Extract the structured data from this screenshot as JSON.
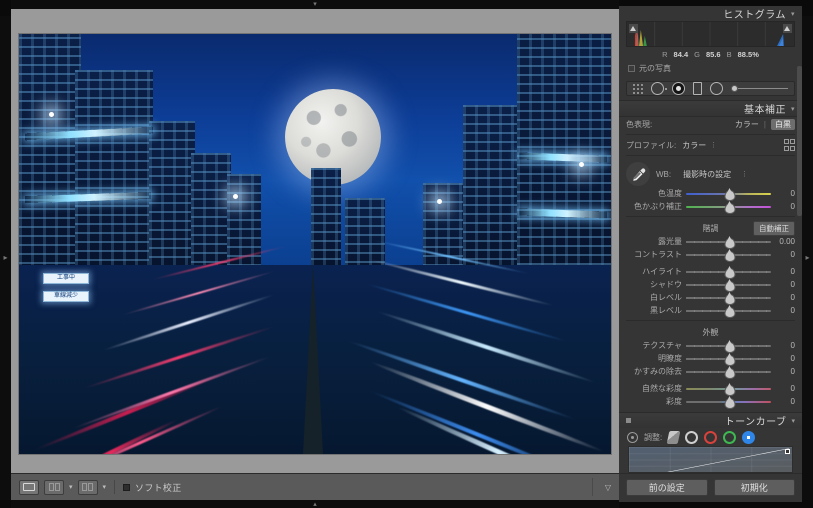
{
  "histogram": {
    "title": "ヒストグラム",
    "collapse_icon": "triangle-down-icon",
    "readout": {
      "r_label": "R",
      "r_value": "84.4",
      "g_label": "G",
      "g_value": "85.6",
      "b_label": "B",
      "b_value": "88.5%"
    },
    "original_photo_label": "元の写真",
    "shadow_clip_icon": "shadow-clipping-icon",
    "highlight_clip_icon": "highlight-clipping-icon"
  },
  "toolstrip": {
    "mask_icon": "mask-grid-icon",
    "spot_icon": "spot-removal-icon",
    "redeye_icon": "red-eye-icon",
    "crop_icon": "crop-overlay-icon",
    "radial_icon": "radial-filter-icon",
    "slider_icon": "amount-slider"
  },
  "basic": {
    "title": "基本補正",
    "treatment_label": "色表現:",
    "treatment_color": "カラー",
    "treatment_bw": "白黒",
    "profile_label": "プロファイル:",
    "profile_value": "カラー",
    "profile_menu_icon": "chevron-icon",
    "profile_browser_icon": "profile-browser-icon",
    "eyedropper_icon": "white-balance-eyedropper-icon",
    "wb_label": "WB:",
    "wb_value": "撮影時の設定",
    "wb_menu_icon": "chevron-icon",
    "wb_sliders": [
      {
        "name": "色温度",
        "value": "0",
        "track": "temp"
      },
      {
        "name": "色かぶり補正",
        "value": "0",
        "track": "tint"
      }
    ],
    "tone_title": "階調",
    "auto_label": "自動補正",
    "tone_sliders": [
      {
        "name": "露光量",
        "value": "0.00",
        "track": "plain"
      },
      {
        "name": "コントラスト",
        "value": "0",
        "track": "plain"
      }
    ],
    "tone_sliders2": [
      {
        "name": "ハイライト",
        "value": "0",
        "track": "plain"
      },
      {
        "name": "シャドウ",
        "value": "0",
        "track": "plain"
      },
      {
        "name": "白レベル",
        "value": "0",
        "track": "plain"
      },
      {
        "name": "黒レベル",
        "value": "0",
        "track": "plain"
      }
    ],
    "presence_title": "外観",
    "presence_sliders": [
      {
        "name": "テクスチャ",
        "value": "0",
        "track": "plain"
      },
      {
        "name": "明瞭度",
        "value": "0",
        "track": "plain"
      },
      {
        "name": "かすみの除去",
        "value": "0",
        "track": "plain"
      }
    ],
    "presence_sliders2": [
      {
        "name": "自然な彩度",
        "value": "0",
        "track": "vib"
      },
      {
        "name": "彩度",
        "value": "0",
        "track": "sat"
      }
    ]
  },
  "tone_curve": {
    "title": "トーンカーブ",
    "collapse_icon": "triangle-down-icon",
    "adjust_label": "調整:",
    "target_icon": "targeted-adjustment-icon",
    "channels": [
      "mix-curve-icon",
      "rgb-channel-icon",
      "red-channel-icon",
      "green-channel-icon",
      "blue-channel-icon"
    ]
  },
  "footer": {
    "previous_label": "前の設定",
    "reset_label": "初期化"
  },
  "toolbar": {
    "loupe_icon": "loupe-view-icon",
    "compare_icon": "before-after-compare-icon",
    "compare_arrow_icon": "chevron-down-icon",
    "survey_icon": "survey-view-icon",
    "survey_arrow_icon": "chevron-down-icon",
    "soft_proof_label": "ソフト校正",
    "soft_proof_checkbox": "soft-proofing-checkbox",
    "menu_icon": "toolbar-menu-icon"
  },
  "panels": {
    "left_collapse_icon": "left-panel-toggle-icon",
    "right_collapse_icon": "right-panel-toggle-icon",
    "top_collapse_icon": "top-panel-toggle-icon",
    "bottom_collapse_icon": "bottom-panel-toggle-icon"
  },
  "photo": {
    "description": "夜景の高速道路の光跡と満月",
    "sign_construction": "工事中",
    "sign_lane": "車線減少"
  },
  "colors": {
    "panel_bg": "#353535",
    "canvas_bg": "#9a9a9a",
    "accent_blue": "#2f86e8",
    "text": "#d6d6d6"
  }
}
